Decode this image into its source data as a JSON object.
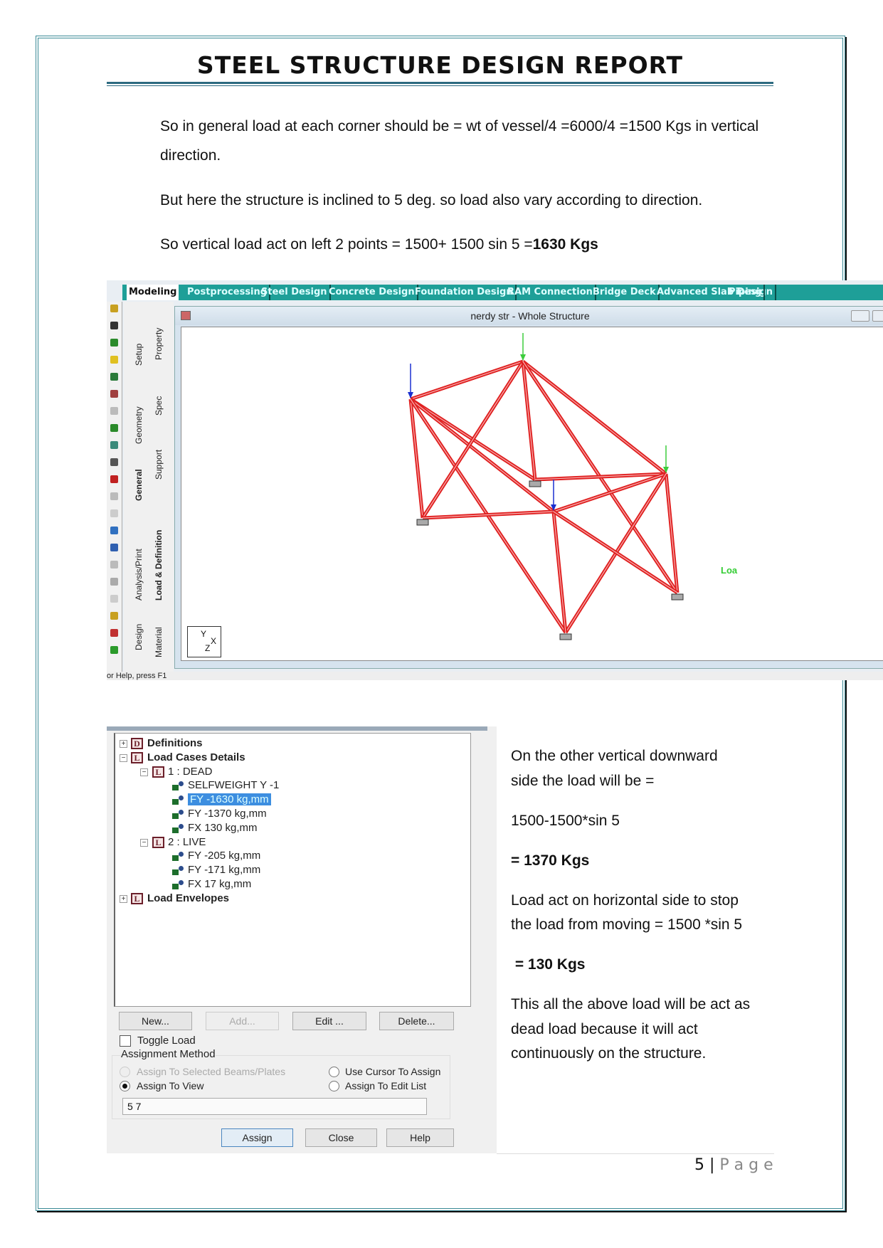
{
  "document": {
    "title": "STEEL STRUCTURE DESIGN REPORT",
    "paragraphs": {
      "p1a": "So in general load at each corner should be = wt of vessel/4 =6000/4 =1500 Kgs in vertical",
      "p1b": "direction.",
      "p2": "But here the structure is inclined to 5 deg. so load also vary according to direction.",
      "p3_text": "So vertical load act on left 2 points = 1500+ 1500 sin 5 =",
      "p3_bold": "1630 Kgs"
    },
    "right_column": {
      "l1": "On the other vertical downward",
      "l2": "side the load will be =",
      "l3": "1500-1500*sin 5",
      "l4": "= 1370 Kgs",
      "l5": "Load act on horizontal side to stop",
      "l6": "the load from moving = 1500 *sin 5",
      "l7": " = 130 Kgs",
      "l8": "This all the above load will be act as",
      "l9": "dead load because it will act",
      "l10": "continuously on the structure."
    },
    "footer": {
      "page_number": "5",
      "separator": "|",
      "page_label": "P a g e"
    }
  },
  "staad_window": {
    "tabs": [
      "Modeling",
      "Postprocessing",
      "Steel Design",
      "Concrete Design",
      "Foundation Design",
      "RAM Connection",
      "Bridge Deck",
      "Advanced Slab Design",
      "Piping"
    ],
    "active_tab": "Modeling",
    "side_tabs_outer": [
      "Setup",
      "Geometry",
      "General",
      "Analysis/Print",
      "Design"
    ],
    "side_tabs_inner": [
      "Property",
      "Spec",
      "Support",
      "Load & Definition",
      "Material"
    ],
    "view_title": "nerdy str - Whole Structure",
    "axis_labels": {
      "y": "Y",
      "x": "X",
      "z": "Z"
    },
    "side_label_partial": "Loa",
    "status_text": "or Help, press F1",
    "colors": {
      "tab_bar": "#1e9f98",
      "members": "#e02020",
      "load_arrow_blue": "#1a2fd0",
      "load_arrow_green": "#3ccc3c"
    }
  },
  "load_dialog": {
    "tree": [
      {
        "label": "Definitions",
        "icon": "D"
      },
      {
        "label": "Load Cases Details",
        "icon": "L"
      },
      {
        "label": "1 : DEAD",
        "icon": "L"
      },
      {
        "label": "SELFWEIGHT Y -1"
      },
      {
        "label": "FY -1630 kg,mm",
        "selected": true
      },
      {
        "label": "FY -1370 kg,mm"
      },
      {
        "label": "FX 130 kg,mm"
      },
      {
        "label": "2 : LIVE",
        "icon": "L"
      },
      {
        "label": "FY -205 kg,mm"
      },
      {
        "label": "FY -171 kg,mm"
      },
      {
        "label": "FX 17 kg,mm"
      },
      {
        "label": "Load Envelopes",
        "icon": "L"
      }
    ],
    "buttons": {
      "new": "New...",
      "add": "Add...",
      "edit": "Edit ...",
      "delete": "Delete...",
      "assign": "Assign",
      "close": "Close",
      "help": "Help"
    },
    "toggle_load": {
      "label": "Toggle Load",
      "checked": false
    },
    "assignment_method": {
      "label": "Assignment Method",
      "options": [
        "Assign To Selected Beams/Plates",
        "Use Cursor To Assign",
        "Assign To View",
        "Assign To Edit List"
      ],
      "selected": "Assign To View"
    },
    "edit_list_value": "5 7"
  }
}
